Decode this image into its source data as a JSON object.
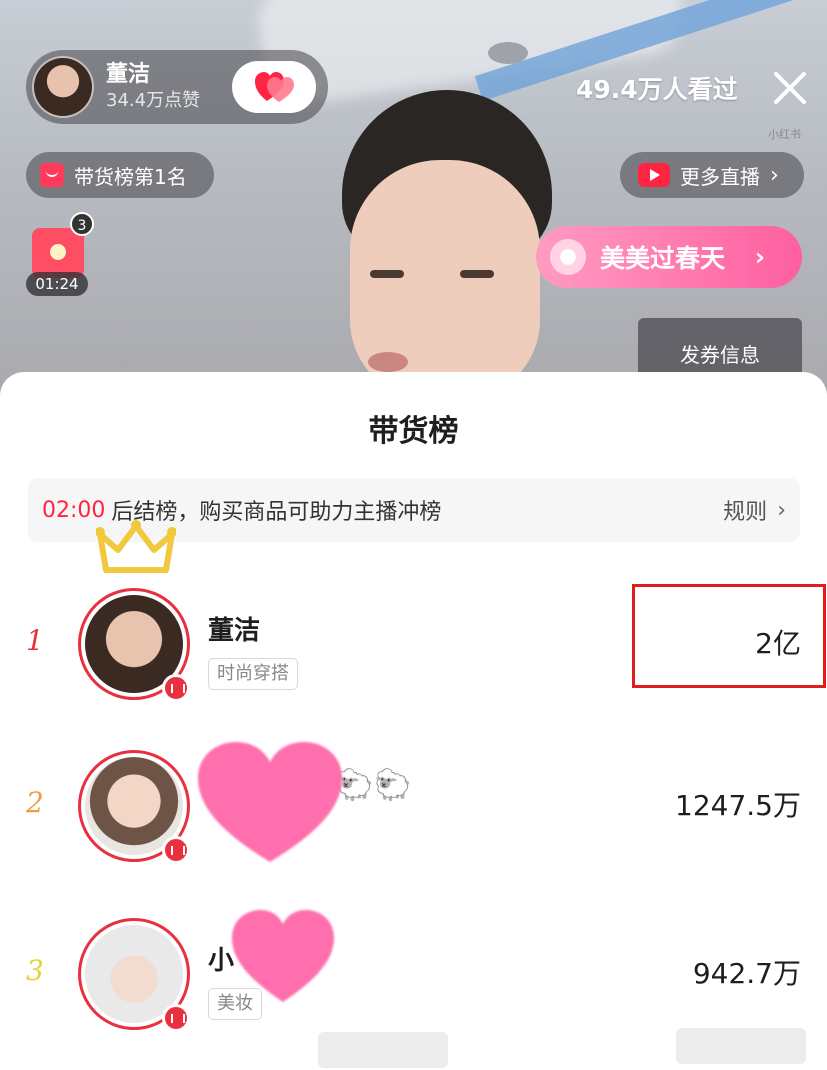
{
  "host": {
    "name": "董洁",
    "likes": "34.4万点赞"
  },
  "viewers": "49.4万人看过",
  "watermark": "小红书",
  "rank_badge": "带货榜第1名",
  "more_live": "更多直播",
  "red_packet": {
    "count": "3",
    "timer": "01:24"
  },
  "event": "美美过春天",
  "coupon": "发券信息",
  "sheet": {
    "title": "带货榜",
    "notice_countdown": "02:00",
    "notice_text": "后结榜，购买商品可助力主播冲榜",
    "rules": "规则"
  },
  "leaderboard": [
    {
      "rank": "1",
      "name": "董洁",
      "tag": "时尚穿搭",
      "value": "2亿",
      "rank_color": "#e8303f"
    },
    {
      "rank": "2",
      "name": "",
      "tag": "",
      "value": "1247.5万",
      "rank_color": "#e8a040"
    },
    {
      "rank": "3",
      "name": "小      ni",
      "tag": "美妆",
      "value": "942.7万",
      "rank_color": "#e5d430"
    }
  ],
  "colors": {
    "accent": "#ff2442",
    "highlight_box": "#e01e1e",
    "event_pill": "#ff6fa8"
  }
}
